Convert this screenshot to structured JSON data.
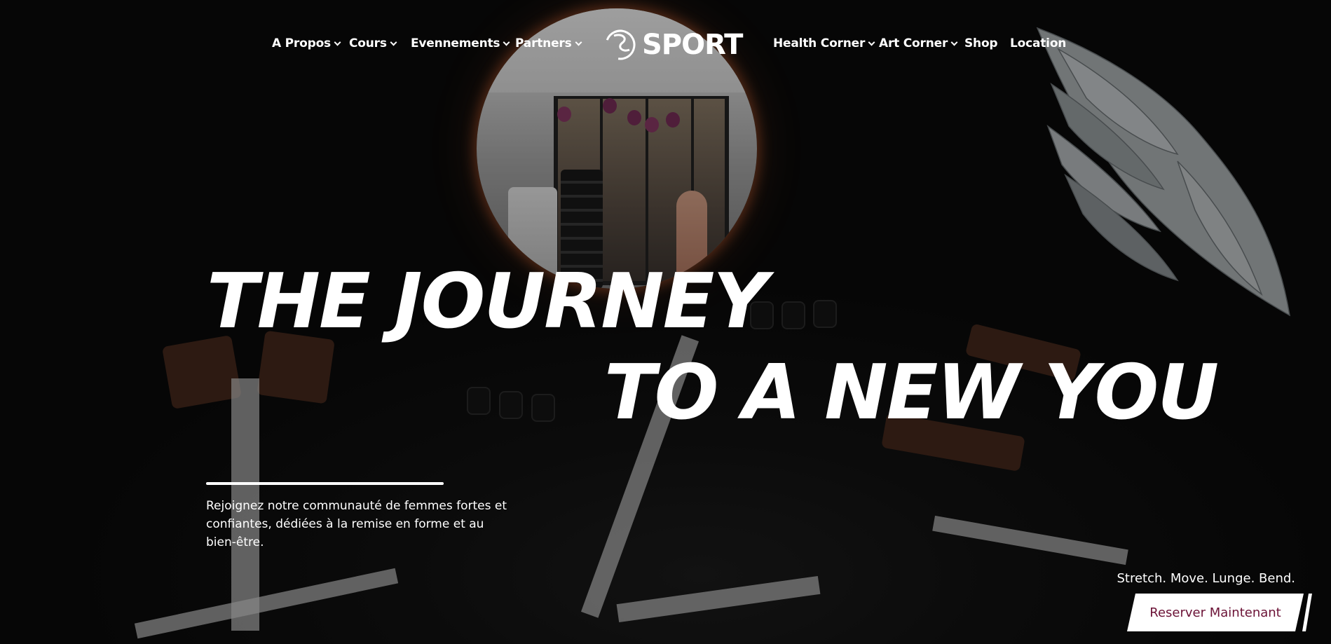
{
  "nav": {
    "left_items": [
      {
        "label": "A Propos",
        "has_dropdown": true
      },
      {
        "label": "Cours",
        "has_dropdown": true
      },
      {
        "label": "Evennements",
        "has_dropdown": true
      },
      {
        "label": "Partners",
        "has_dropdown": true
      }
    ],
    "right_items": [
      {
        "label": "Health Corner",
        "has_dropdown": true
      },
      {
        "label": "Art Corner",
        "has_dropdown": true
      },
      {
        "label": "Shop",
        "has_dropdown": false
      },
      {
        "label": "Location",
        "has_dropdown": false
      }
    ],
    "logo_text": "SPORT"
  },
  "hero": {
    "headline_line1": "THE JOURNEY",
    "headline_line2": "TO A NEW YOU",
    "intro": "Rejoignez notre communauté de femmes fortes et confiantes, dédiées à la remise en forme et au bien-être.",
    "tagline": "Stretch. Move. Lunge. Bend.",
    "cta_label": "Reserver Maintenant"
  },
  "colors": {
    "cta_text": "#6b1236",
    "cta_background": "#ffffff",
    "mirror_glow": "#ff7a3c"
  },
  "icons": [
    "chevron-down-icon",
    "sport-logo-icon"
  ]
}
